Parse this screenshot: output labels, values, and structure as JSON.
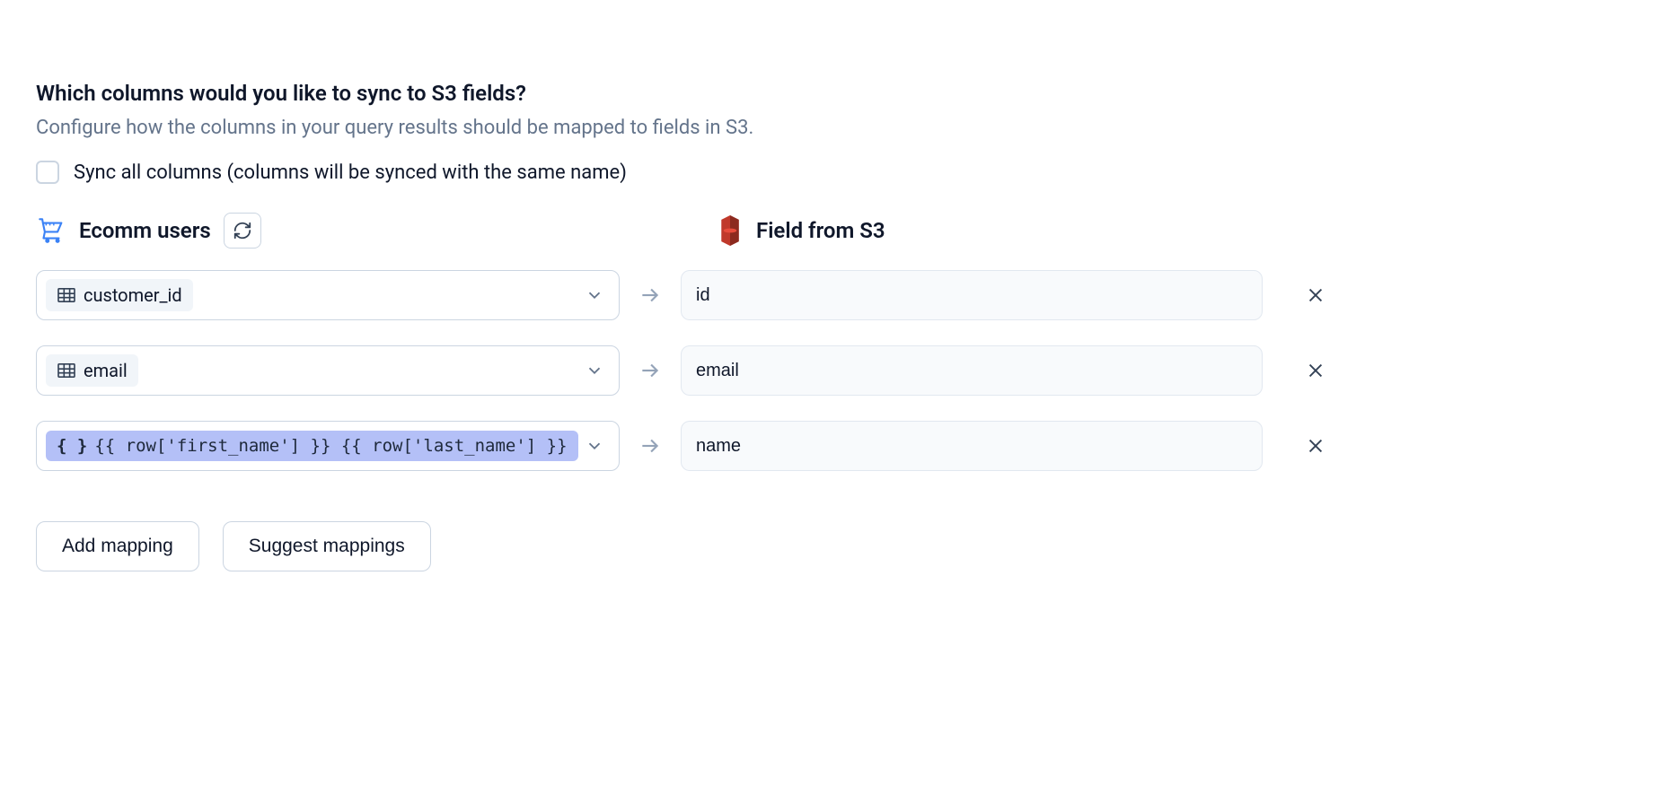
{
  "heading": "Which columns would you like to sync to S3 fields?",
  "subheading": "Configure how the columns in your query results should be mapped to fields in S3.",
  "sync_all": {
    "label": "Sync all columns (columns will be synced with the same name)",
    "checked": false
  },
  "source": {
    "title": "Ecomm users",
    "icon": "shopping-cart-icon"
  },
  "destination": {
    "title": "Field from S3",
    "icon": "s3-icon"
  },
  "mappings": [
    {
      "source_type": "column",
      "source_value": "customer_id",
      "dest_value": "id"
    },
    {
      "source_type": "column",
      "source_value": "email",
      "dest_value": "email"
    },
    {
      "source_type": "template",
      "source_value": "{{ row['first_name'] }} {{ row['last_name'] }}",
      "dest_value": "name"
    }
  ],
  "buttons": {
    "add_mapping": "Add mapping",
    "suggest_mappings": "Suggest mappings"
  }
}
